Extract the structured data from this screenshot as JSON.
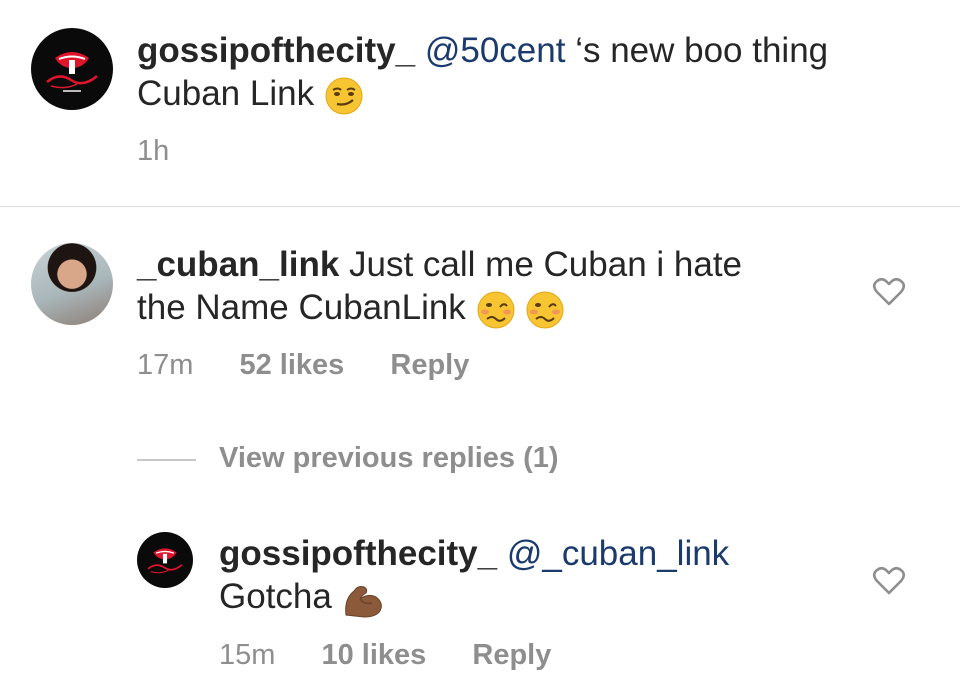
{
  "caption": {
    "username": "gossipofthecity_",
    "mention": "@50cent",
    "text_line1": " ‘s new boo thing",
    "text_line2": "Cuban Link",
    "time": "1h",
    "emoji": "smirking-face"
  },
  "comment": {
    "username": "_cuban_link",
    "text_line1": " Just call me Cuban i hate",
    "text_line2": "the Name CubanLink",
    "time": "17m",
    "likes": "52 likes",
    "reply_label": "Reply",
    "emoji": "woozy-face"
  },
  "view_replies": {
    "label": "View previous replies (1)"
  },
  "reply": {
    "username": "gossipofthecity_",
    "mention": "@_cuban_link",
    "text_line2": "Gotcha",
    "time": "15m",
    "likes": "10 likes",
    "reply_label": "Reply",
    "emoji": "flexed-biceps"
  },
  "colors": {
    "mention": "#1b3a6d",
    "meta": "#8e8e8e",
    "logo_red": "#e0142b"
  }
}
